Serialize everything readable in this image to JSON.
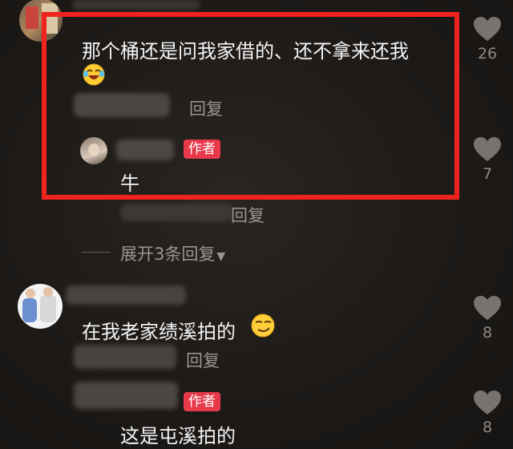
{
  "highlight_color": "#f0231e",
  "author_badge_color": "#e8394a",
  "comments": [
    {
      "text": "那个桶还是问我家借的、还不拿来还我",
      "emoji": "laughing-crying-emoji",
      "likes": "26",
      "reply_label": "回复",
      "author_reply": {
        "badge": "作者",
        "text": "牛",
        "likes": "7"
      }
    }
  ],
  "thread_reply_label": "回复",
  "expand_replies": "展开3条回复",
  "comment2": {
    "text": "在我老家绩溪拍的",
    "emoji": "smirk-emoji",
    "likes": "8",
    "reply_label": "回复",
    "author_reply": {
      "badge": "作者",
      "text": "这是屯溪拍的",
      "likes": "8"
    }
  }
}
